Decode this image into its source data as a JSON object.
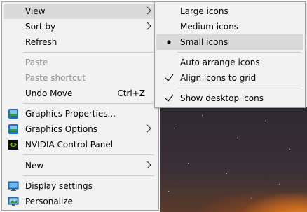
{
  "context_menu": {
    "items": [
      {
        "label": "View",
        "submenu": true
      },
      {
        "label": "Sort by",
        "submenu": true
      },
      {
        "label": "Refresh"
      },
      {
        "label": "Paste",
        "disabled": true
      },
      {
        "label": "Paste shortcut",
        "disabled": true
      },
      {
        "label": "Undo Move",
        "shortcut": "Ctrl+Z"
      },
      {
        "label": "Graphics Properties..."
      },
      {
        "label": "Graphics Options",
        "submenu": true
      },
      {
        "label": "NVIDIA Control Panel"
      },
      {
        "label": "New",
        "submenu": true
      },
      {
        "label": "Display settings"
      },
      {
        "label": "Personalize"
      }
    ]
  },
  "view_submenu": {
    "items": [
      {
        "label": "Large icons"
      },
      {
        "label": "Medium icons"
      },
      {
        "label": "Small icons",
        "selected": true,
        "mark": "bullet"
      },
      {
        "label": "Auto arrange icons"
      },
      {
        "label": "Align icons to grid",
        "mark": "check"
      },
      {
        "label": "Show desktop icons",
        "mark": "check"
      }
    ]
  },
  "colors": {
    "menu_bg": "#f2f2f2",
    "hover_bg": "#dadada",
    "disabled_text": "#8e8e8e",
    "separator": "#c8c8c8"
  }
}
